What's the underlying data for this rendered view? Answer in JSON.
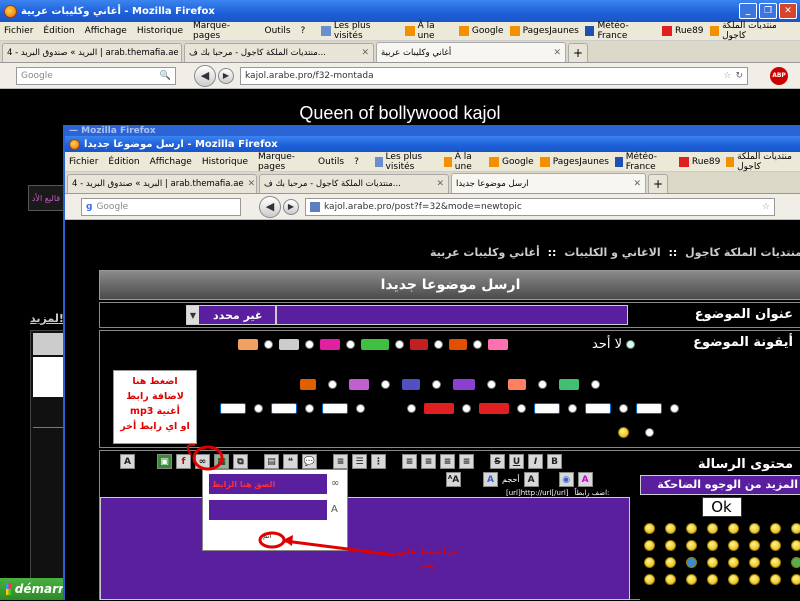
{
  "back_window": {
    "title": "أغاني وكليبات عربية - Mozilla Firefox",
    "menu": [
      "Fichier",
      "Édition",
      "Affichage",
      "Historique",
      "Marque-pages",
      "Outils",
      "?"
    ],
    "bookmarks": [
      "Les plus visités",
      "À la une",
      "Google",
      "PagesJaunes",
      "Météo-France",
      "Rue89",
      "منتديات الملكة كاجول"
    ],
    "tabs": [
      {
        "label": "البريد » صندوق البريد - 4 | arab.themafia.ae"
      },
      {
        "label": "منتديات الملكة كاجول - مرحبا بك ف..."
      },
      {
        "label": "أغاني وكليبات عربية"
      }
    ],
    "search_placeholder": "Google",
    "url": "kajol.arabe.pro/f32-montada",
    "abp": "ABP",
    "page_title": "Queen of bollywood kajol",
    "left_fragment": "لمزيد!",
    "left_banner": "قاليع الأد"
  },
  "front_window": {
    "title": "ارسل موضوعا جديدا - Mozilla Firefox",
    "menu": [
      "Fichier",
      "Édition",
      "Affichage",
      "Historique",
      "Marque-pages",
      "Outils",
      "?"
    ],
    "bookmarks": [
      "Les plus visités",
      "À la une",
      "Google",
      "PagesJaunes",
      "Météo-France",
      "Rue89",
      "منتديات الملكة كاجول"
    ],
    "tabs": [
      {
        "label": "البريد » صندوق البريد - 4 | arab.themafia.ae"
      },
      {
        "label": "منتديات الملكة كاجول - مرحبا بك ف..."
      },
      {
        "label": "ارسل موضوعا جديدا"
      }
    ],
    "search_placeholder": "Google",
    "url": "kajol.arabe.pro/post?f=32&mode=newtopic"
  },
  "forum": {
    "breadcrumb": [
      "منتديات الملكة كاجول",
      "الاغاني و الكليبات",
      "أغاني وكليبات عربية"
    ],
    "breadcrumb_sep": "::",
    "header": "ارسل موضوعا جديدا",
    "subject_label": "عنوان الموضوع",
    "subject_select": "غير محدد",
    "icon_label": "أيقونة الموضوع",
    "none_option": "لا أحد",
    "message_label": "محتوى الرسالة",
    "link_prompt": "اضف رابطاً:",
    "link_format": "[url]http://url[/url]",
    "popup_field_label": "الصق هنا الرابط",
    "popup_ok": "اتم",
    "smilies_header": "المزيد من الوجوه الضاحكة",
    "smilies_ok": "Ok",
    "font_label": "أحجم"
  },
  "annotations": {
    "note1": [
      "اضغط هنا",
      "لاضافة رابط",
      "أغنية mp3",
      "او اي رابط أخر"
    ],
    "note2": [
      "ثم اضغط على",
      "نعم"
    ],
    "accent": "#e00000"
  },
  "taskbar": {
    "start": "démarrer"
  }
}
